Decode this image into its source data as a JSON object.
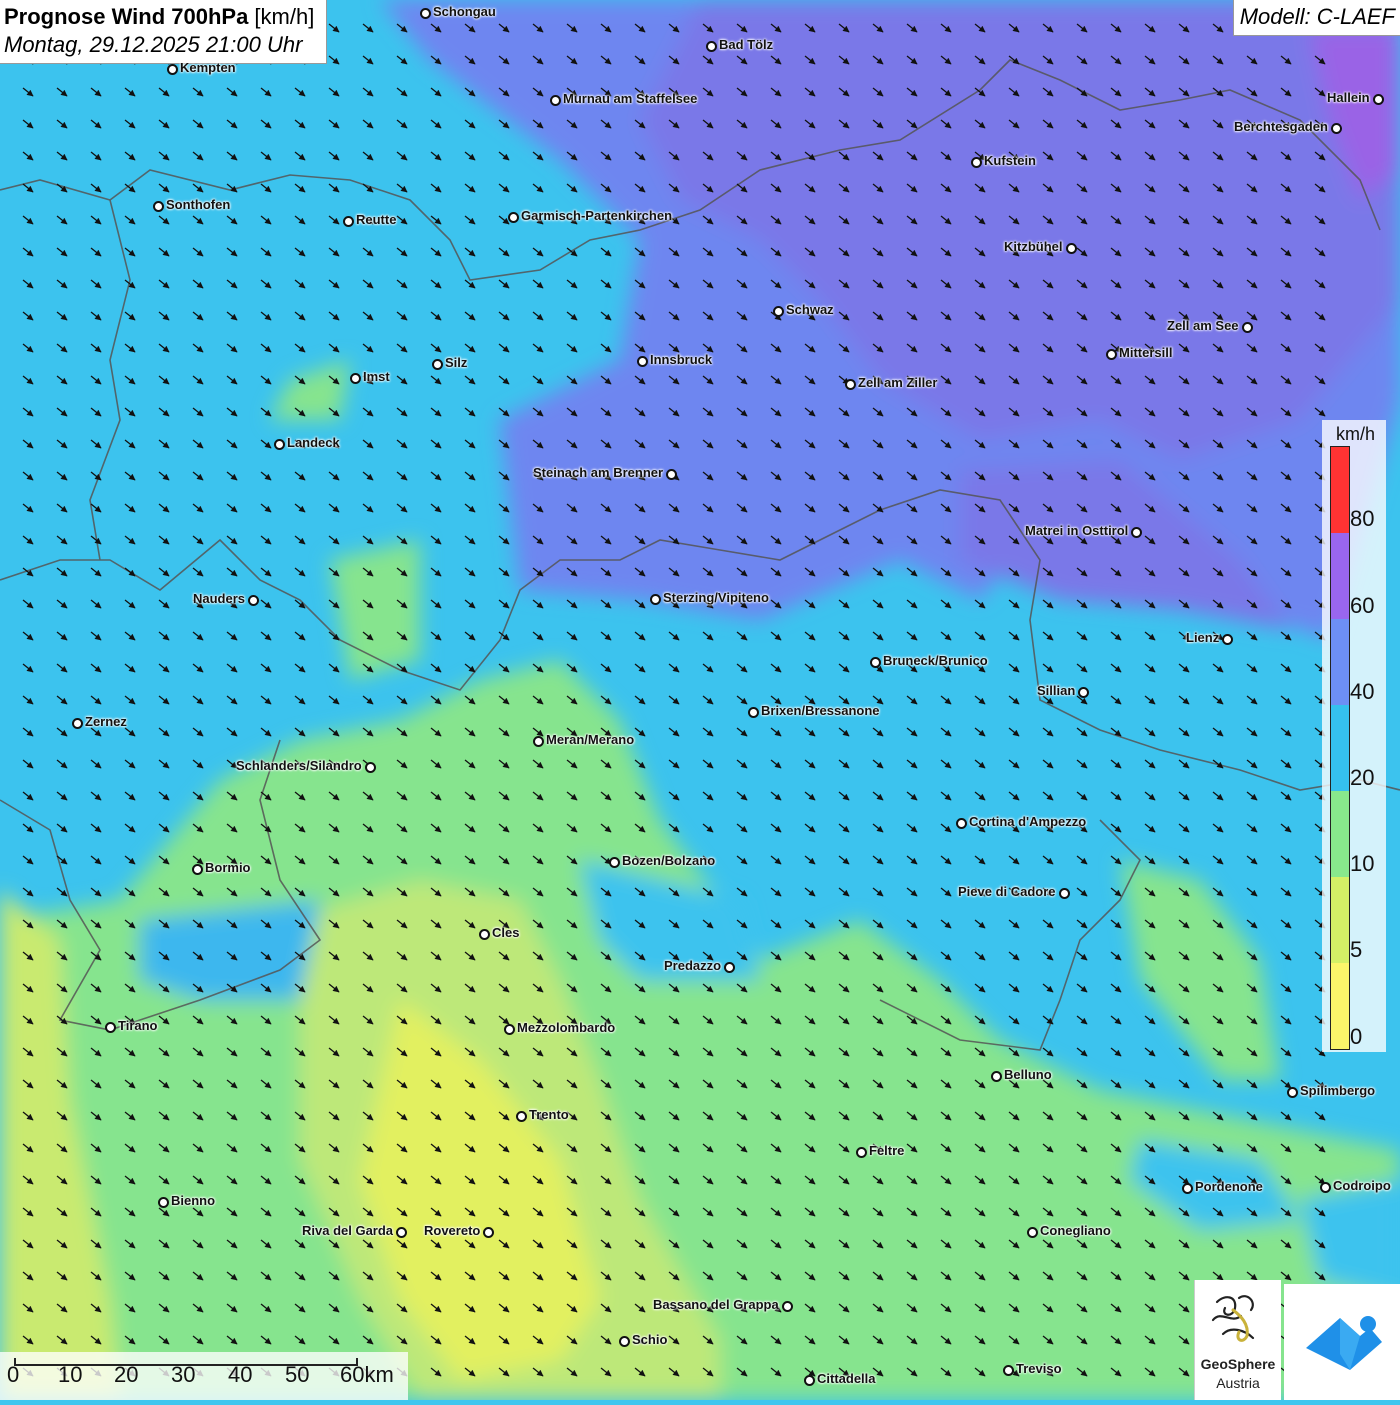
{
  "header": {
    "title_bold": "Prognose Wind 700hPa",
    "title_unit": " [km/h]",
    "subtitle": "Montag, 29.12.2025 21:00 Uhr",
    "model": "Modell: C-LAEF"
  },
  "legend": {
    "unit": "km/h",
    "ticks": [
      "80",
      "60",
      "40",
      "20",
      "10",
      "5",
      "0"
    ],
    "colors": [
      "#ff3333",
      "#9966ee",
      "#6d8ff5",
      "#35c0ee",
      "#88e88c",
      "#d4f066",
      "#fbf56a"
    ]
  },
  "scalebar": {
    "ticks": [
      "0",
      "10",
      "20",
      "30",
      "40",
      "50",
      "60km"
    ]
  },
  "cities": [
    {
      "name": "Schongau"
    },
    {
      "name": "Bad Tölz"
    },
    {
      "name": "Kempten"
    },
    {
      "name": "Murnau am Staffelsee"
    },
    {
      "name": "Hallein"
    },
    {
      "name": "Berchtesgaden"
    },
    {
      "name": "Kufstein"
    },
    {
      "name": "Sonthofen"
    },
    {
      "name": "Reutte"
    },
    {
      "name": "Garmisch-Partenkirchen"
    },
    {
      "name": "Kitzbühel"
    },
    {
      "name": "Schwaz"
    },
    {
      "name": "Zell am See"
    },
    {
      "name": "Mittersill"
    },
    {
      "name": "Silz"
    },
    {
      "name": "Innsbruck"
    },
    {
      "name": "Imst"
    },
    {
      "name": "Zell am Ziller"
    },
    {
      "name": "Landeck"
    },
    {
      "name": "Steinach am Brenner"
    },
    {
      "name": "Matrei in Osttirol"
    },
    {
      "name": "Nauders"
    },
    {
      "name": "Sterzing/Vipiteno"
    },
    {
      "name": "Lienz"
    },
    {
      "name": "Bruneck/Brunico"
    },
    {
      "name": "Sillian"
    },
    {
      "name": "Zernez"
    },
    {
      "name": "Brixen/Bressanone"
    },
    {
      "name": "Meran/Merano"
    },
    {
      "name": "Schlanders/Silandro"
    },
    {
      "name": "Cortina d'Ampezzo"
    },
    {
      "name": "Bozen/Bolzano"
    },
    {
      "name": "Bormio"
    },
    {
      "name": "Pieve di Cadore"
    },
    {
      "name": "Cles"
    },
    {
      "name": "Predazzo"
    },
    {
      "name": "Tirano"
    },
    {
      "name": "Mezzolombardo"
    },
    {
      "name": "Belluno"
    },
    {
      "name": "Spilimbergo"
    },
    {
      "name": "Trento"
    },
    {
      "name": "Feltre"
    },
    {
      "name": "Bienno"
    },
    {
      "name": "Pordenone"
    },
    {
      "name": "Codroipo"
    },
    {
      "name": "Riva del Garda"
    },
    {
      "name": "Rovereto"
    },
    {
      "name": "Conegliano"
    },
    {
      "name": "Bassano del Grappa"
    },
    {
      "name": "Schio"
    },
    {
      "name": "Treviso"
    },
    {
      "name": "Cittadella"
    }
  ],
  "logos": {
    "geosphere_name": "GeoSphere",
    "geosphere_sub": "Austria",
    "geosphere_icon": "geosphere-logo-icon",
    "app_icon": "weather-app-logo-icon"
  },
  "wind": {
    "direction": "northwest",
    "arrow_color": "#111111"
  }
}
